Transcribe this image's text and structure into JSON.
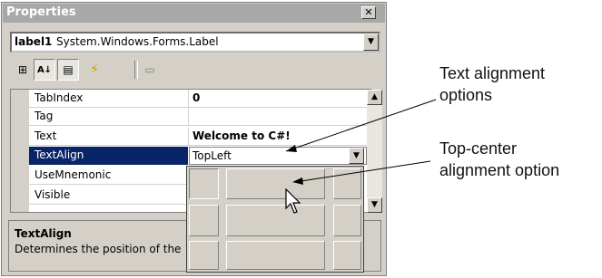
{
  "window": {
    "title": "Properties",
    "close_glyph": "✕"
  },
  "object_selector": {
    "name": "label1",
    "type": "System.Windows.Forms.Label",
    "drop_glyph": "▼"
  },
  "toolbar": [
    {
      "icon": "categorized-icon",
      "glyph": "⊞"
    },
    {
      "icon": "sort-alphabetical-icon",
      "glyph": "A↓"
    },
    {
      "icon": "properties-icon",
      "glyph": "▤"
    },
    {
      "icon": "events-icon",
      "glyph": "⚡"
    },
    {
      "icon": "property-pages-icon",
      "glyph": "▭"
    }
  ],
  "properties": [
    {
      "name": "TabIndex",
      "value": "0",
      "bold": true
    },
    {
      "name": "Tag",
      "value": ""
    },
    {
      "name": "Text",
      "value": "Welcome to C#!",
      "bold": true
    },
    {
      "name": "TextAlign",
      "value": "TopLeft",
      "selected": true
    },
    {
      "name": "UseMnemonic",
      "value": ""
    },
    {
      "name": "Visible",
      "value": ""
    }
  ],
  "description": {
    "title": "TextAlign",
    "text": "Determines the position of the text within the label."
  },
  "callouts": {
    "text_alignment": [
      "Text alignment",
      "options"
    ],
    "top_center": [
      "Top-center",
      "alignment option"
    ]
  },
  "colors": {
    "selection": "#0a246a",
    "face": "#d4d0c8"
  }
}
